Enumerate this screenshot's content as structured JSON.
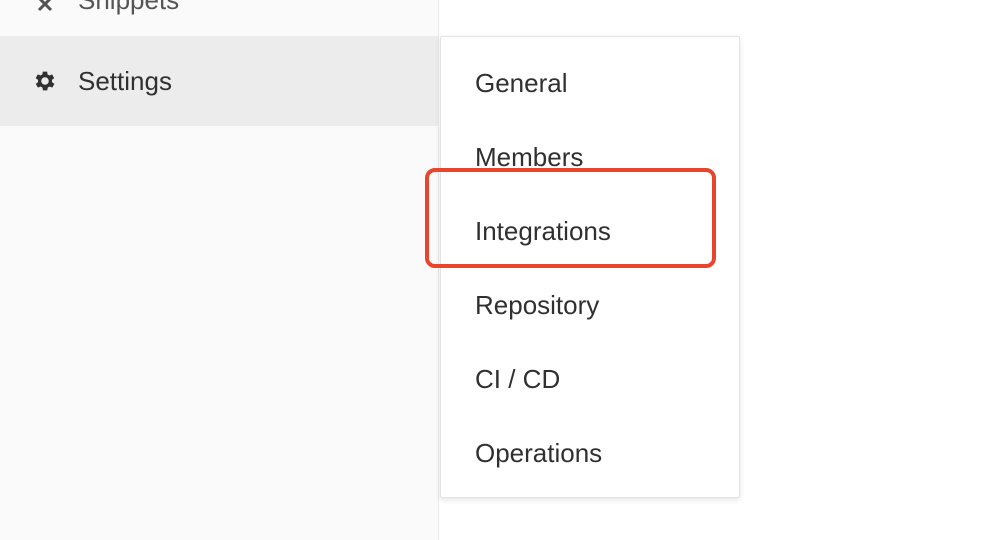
{
  "sidebar": {
    "items": [
      {
        "label": "Snippets",
        "icon": "snippet-icon"
      },
      {
        "label": "Settings",
        "icon": "gear-icon"
      }
    ]
  },
  "flyout": {
    "items": [
      {
        "label": "General"
      },
      {
        "label": "Members"
      },
      {
        "label": "Integrations"
      },
      {
        "label": "Repository"
      },
      {
        "label": "CI / CD"
      },
      {
        "label": "Operations"
      }
    ]
  },
  "colors": {
    "highlight": "#e8442e",
    "active_bg": "#ececec",
    "sidebar_bg": "#fafafa",
    "text": "#303030"
  }
}
